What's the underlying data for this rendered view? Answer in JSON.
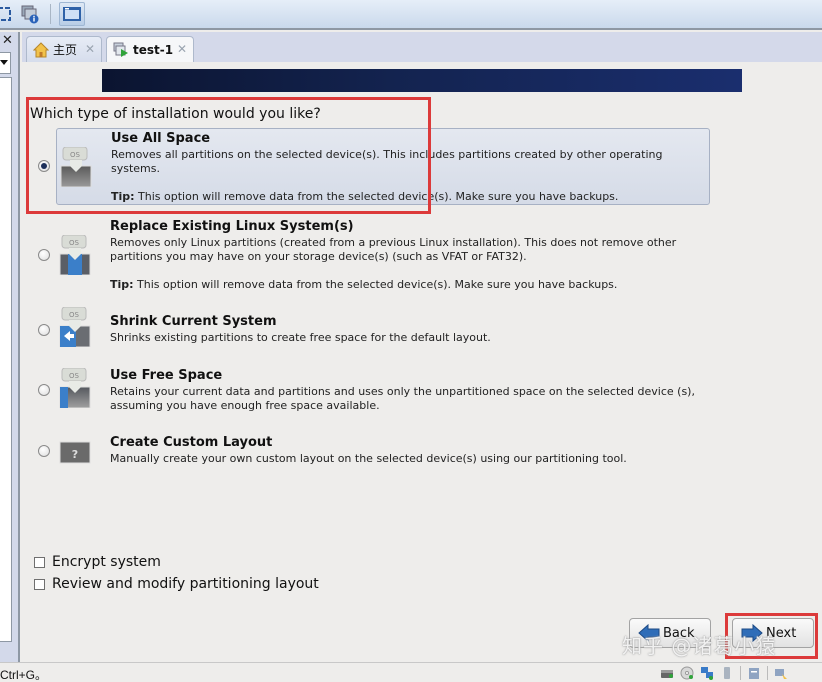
{
  "tabs": [
    {
      "label": "主页",
      "icon": "home-icon"
    },
    {
      "label": "test-1",
      "icon": "vm-running-icon",
      "active": true
    }
  ],
  "question": "Which type of installation would you like?",
  "options": [
    {
      "title": "Use All Space",
      "desc": "Removes all partitions on the selected device(s).  This includes partitions created by other operating systems.",
      "tip_label": "Tip:",
      "tip": " This option will remove data from the selected device(s).  Make sure you have backups.",
      "selected": true
    },
    {
      "title": "Replace Existing Linux System(s)",
      "desc": "Removes only Linux partitions (created from a previous Linux installation).  This does not remove other partitions you may have on your storage device(s) (such as VFAT or FAT32).",
      "tip_label": "Tip:",
      "tip": " This option will remove data from the selected device(s).  Make sure you have backups.",
      "selected": false
    },
    {
      "title": "Shrink Current System",
      "desc": "Shrinks existing partitions to create free space for the default layout.",
      "selected": false
    },
    {
      "title": "Use Free Space",
      "desc": "Retains your current data and partitions and uses only the unpartitioned space on the selected device (s), assuming you have enough free space available.",
      "selected": false
    },
    {
      "title": "Create Custom Layout",
      "desc": "Manually create your own custom layout on the selected device(s) using our partitioning tool.",
      "selected": false
    }
  ],
  "checkboxes": [
    {
      "label": "Encrypt system",
      "checked": false
    },
    {
      "label": "Review and modify partitioning layout",
      "checked": false
    }
  ],
  "buttons": {
    "back": "Back",
    "next": "Next"
  },
  "icon_text": {
    "os": "OS",
    "custom": "?"
  },
  "status_text": "Ctrl+G。",
  "watermark": "知乎 @诸葛小猿",
  "colors": {
    "highlight": "#dc3a3a",
    "banner": "#13234f",
    "selected_card": "#d5dbe7"
  }
}
